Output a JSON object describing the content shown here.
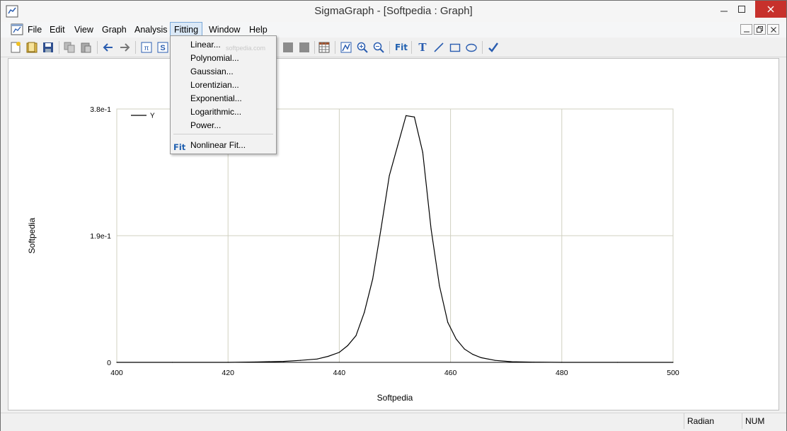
{
  "window": {
    "title": "SigmaGraph - [Softpedia : Graph]"
  },
  "menu": {
    "items": [
      {
        "label": "File"
      },
      {
        "label": "Edit"
      },
      {
        "label": "View"
      },
      {
        "label": "Graph"
      },
      {
        "label": "Analysis"
      },
      {
        "label": "Fitting"
      },
      {
        "label": "Window"
      },
      {
        "label": "Help"
      }
    ],
    "open_menu": "Fitting"
  },
  "fitting_menu": {
    "items": [
      {
        "label": "Linear..."
      },
      {
        "label": "Polynomial..."
      },
      {
        "label": "Gaussian..."
      },
      {
        "label": "Lorentizian..."
      },
      {
        "label": "Exponential..."
      },
      {
        "label": "Logarithmic..."
      },
      {
        "label": "Power..."
      },
      {
        "label": "Nonlinear Fit...",
        "icon": "fit-icon",
        "icon_text": "Fit"
      }
    ]
  },
  "toolbar": {
    "fit_label": "Fit",
    "text_tool_label": "T",
    "pi_label": "π",
    "s_label": "S",
    "icons": [
      "new-icon",
      "open-icon",
      "save-icon",
      "copy-icon",
      "paste-icon",
      "undo-icon",
      "redo-icon",
      "pi-icon",
      "script-icon",
      "gray-square-icon",
      "gray-square-icon",
      "datasheet-icon",
      "autoscale-icon",
      "zoom-in-icon",
      "zoom-out-icon",
      "fit-icon",
      "text-icon",
      "line-icon",
      "rectangle-icon",
      "ellipse-icon",
      "check-icon"
    ]
  },
  "watermark": "softpedia.com",
  "status": {
    "mode": "Radian",
    "num": "NUM"
  },
  "chart_data": {
    "type": "line",
    "xlabel": "Softpedia",
    "ylabel": "Softpedia",
    "xlim": [
      400,
      500
    ],
    "ylim": [
      0,
      0.38
    ],
    "x_ticks": [
      400,
      420,
      440,
      460,
      480,
      500
    ],
    "x_tick_labels": [
      "400",
      "420",
      "440",
      "460",
      "480",
      "500"
    ],
    "y_ticks": [
      0,
      0.19,
      0.38
    ],
    "y_tick_labels": [
      "0",
      "1.9e-1",
      "3.8e-1"
    ],
    "grid": true,
    "legend_position": "top-left",
    "line_color": "#000000",
    "series": [
      {
        "name": "Y",
        "x": [
          400,
          410,
          420,
          425,
          430,
          433,
          436,
          438,
          440,
          441.5,
          443,
          444.5,
          446,
          447.5,
          449,
          450.5,
          452,
          453.5,
          455,
          456.5,
          458,
          459.5,
          461,
          462.5,
          464,
          465.5,
          468,
          471,
          475,
          480,
          490,
          500
        ],
        "y": [
          0,
          0,
          0,
          0.0005,
          0.0015,
          0.003,
          0.005,
          0.009,
          0.015,
          0.025,
          0.04,
          0.075,
          0.125,
          0.2,
          0.28,
          0.325,
          0.37,
          0.368,
          0.315,
          0.2,
          0.115,
          0.06,
          0.035,
          0.02,
          0.012,
          0.007,
          0.003,
          0.001,
          0.0003,
          0,
          0,
          0
        ]
      }
    ]
  }
}
